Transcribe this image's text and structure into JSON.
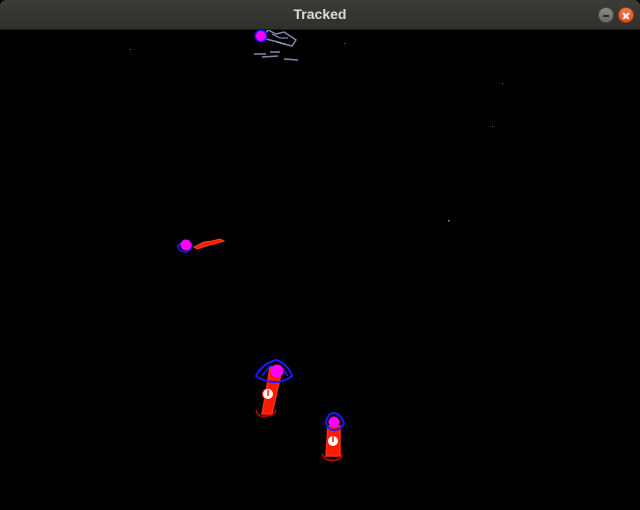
{
  "window": {
    "title": "Tracked",
    "minimize_icon": "minimize-icon",
    "close_icon": "close-icon"
  },
  "view": {
    "background": "#000000",
    "tracked_objects": [
      {
        "id": "object-top",
        "marker_color": "#ff00ff"
      },
      {
        "id": "object-left",
        "marker_color": "#ff00ff"
      },
      {
        "id": "object-center",
        "marker_color": "#ff00ff"
      },
      {
        "id": "object-lower",
        "marker_color": "#ff00ff"
      }
    ],
    "colors": {
      "centroid": "#ff00ff",
      "body": "#ff1a00",
      "contour": "#1a1aff",
      "head": "#ffffff"
    }
  }
}
